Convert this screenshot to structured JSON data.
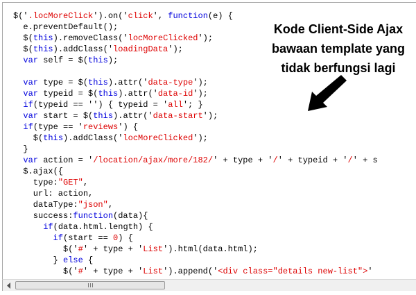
{
  "annotation": {
    "line1": "Kode Client-Side Ajax",
    "line2": "bawaan template yang",
    "line3": "tidak berfungsi lagi"
  },
  "icons": {
    "arrow": "arrow-pointing-down-left-icon",
    "scroll_left": "triangle-left-icon",
    "scroll_grip": "grip-icon"
  },
  "colors": {
    "keyword": "#0000dd",
    "string": "#dd0000",
    "text": "#000000",
    "scrollbar_bg": "#f0f0f0"
  },
  "code_lines": [
    [
      [
        "pln",
        "$('"
      ],
      [
        "str",
        ".locMoreClick"
      ],
      [
        "pln",
        "').on('"
      ],
      [
        "str",
        "click"
      ],
      [
        "pln",
        "', "
      ],
      [
        "kw",
        "function"
      ],
      [
        "pln",
        "(e) {"
      ]
    ],
    [
      [
        "pln",
        "  e.preventDefault();"
      ]
    ],
    [
      [
        "pln",
        "  $("
      ],
      [
        "kw",
        "this"
      ],
      [
        "pln",
        ").removeClass('"
      ],
      [
        "str",
        "locMoreClicked"
      ],
      [
        "pln",
        "');"
      ]
    ],
    [
      [
        "pln",
        "  $("
      ],
      [
        "kw",
        "this"
      ],
      [
        "pln",
        ").addClass('"
      ],
      [
        "str",
        "loadingData"
      ],
      [
        "pln",
        "');"
      ]
    ],
    [
      [
        "pln",
        "  "
      ],
      [
        "kw",
        "var"
      ],
      [
        "pln",
        " self = $("
      ],
      [
        "kw",
        "this"
      ],
      [
        "pln",
        ");"
      ]
    ],
    [
      [
        "pln",
        ""
      ]
    ],
    [
      [
        "pln",
        "  "
      ],
      [
        "kw",
        "var"
      ],
      [
        "pln",
        " type = $("
      ],
      [
        "kw",
        "this"
      ],
      [
        "pln",
        ").attr('"
      ],
      [
        "str",
        "data-type"
      ],
      [
        "pln",
        "');"
      ]
    ],
    [
      [
        "pln",
        "  "
      ],
      [
        "kw",
        "var"
      ],
      [
        "pln",
        " typeid = $("
      ],
      [
        "kw",
        "this"
      ],
      [
        "pln",
        ").attr('"
      ],
      [
        "str",
        "data-id"
      ],
      [
        "pln",
        "');"
      ]
    ],
    [
      [
        "pln",
        "  "
      ],
      [
        "kw",
        "if"
      ],
      [
        "pln",
        "(typeid == '') { typeid = '"
      ],
      [
        "str",
        "all"
      ],
      [
        "pln",
        "'; }"
      ]
    ],
    [
      [
        "pln",
        "  "
      ],
      [
        "kw",
        "var"
      ],
      [
        "pln",
        " start = $("
      ],
      [
        "kw",
        "this"
      ],
      [
        "pln",
        ").attr('"
      ],
      [
        "str",
        "data-start"
      ],
      [
        "pln",
        "');"
      ]
    ],
    [
      [
        "pln",
        "  "
      ],
      [
        "kw",
        "if"
      ],
      [
        "pln",
        "(type == '"
      ],
      [
        "str",
        "reviews"
      ],
      [
        "pln",
        "') {"
      ]
    ],
    [
      [
        "pln",
        "    $("
      ],
      [
        "kw",
        "this"
      ],
      [
        "pln",
        ").addClass('"
      ],
      [
        "str",
        "locMoreClicked"
      ],
      [
        "pln",
        "');"
      ]
    ],
    [
      [
        "pln",
        "  }"
      ]
    ],
    [
      [
        "pln",
        "  "
      ],
      [
        "kw",
        "var"
      ],
      [
        "pln",
        " action = '"
      ],
      [
        "str",
        "/location/ajax/more/182/"
      ],
      [
        "pln",
        "' + type + '"
      ],
      [
        "str",
        "/"
      ],
      [
        "pln",
        "' + typeid + '"
      ],
      [
        "str",
        "/"
      ],
      [
        "pln",
        "' + s"
      ]
    ],
    [
      [
        "pln",
        "  $.ajax({"
      ]
    ],
    [
      [
        "pln",
        "    type:"
      ],
      [
        "str",
        "\"GET\""
      ],
      [
        "pln",
        ","
      ]
    ],
    [
      [
        "pln",
        "    url: action,"
      ]
    ],
    [
      [
        "pln",
        "    dataType:"
      ],
      [
        "str",
        "\"json\""
      ],
      [
        "pln",
        ","
      ]
    ],
    [
      [
        "pln",
        "    success:"
      ],
      [
        "kw",
        "function"
      ],
      [
        "pln",
        "(data){"
      ]
    ],
    [
      [
        "pln",
        "      "
      ],
      [
        "kw",
        "if"
      ],
      [
        "pln",
        "(data.html.length) {"
      ]
    ],
    [
      [
        "pln",
        "        "
      ],
      [
        "kw",
        "if"
      ],
      [
        "pln",
        "(start == "
      ],
      [
        "num",
        "0"
      ],
      [
        "pln",
        ") {"
      ]
    ],
    [
      [
        "pln",
        "          $('"
      ],
      [
        "str",
        "#"
      ],
      [
        "pln",
        "' + type + '"
      ],
      [
        "str",
        "List"
      ],
      [
        "pln",
        "').html(data.html);"
      ]
    ],
    [
      [
        "pln",
        "        } "
      ],
      [
        "kw",
        "else"
      ],
      [
        "pln",
        " {"
      ]
    ],
    [
      [
        "pln",
        "          $('"
      ],
      [
        "str",
        "#"
      ],
      [
        "pln",
        "' + type + '"
      ],
      [
        "str",
        "List"
      ],
      [
        "pln",
        "').append('"
      ],
      [
        "str",
        "<div class=\"details new-list\">"
      ],
      [
        "pln",
        "'"
      ]
    ]
  ]
}
